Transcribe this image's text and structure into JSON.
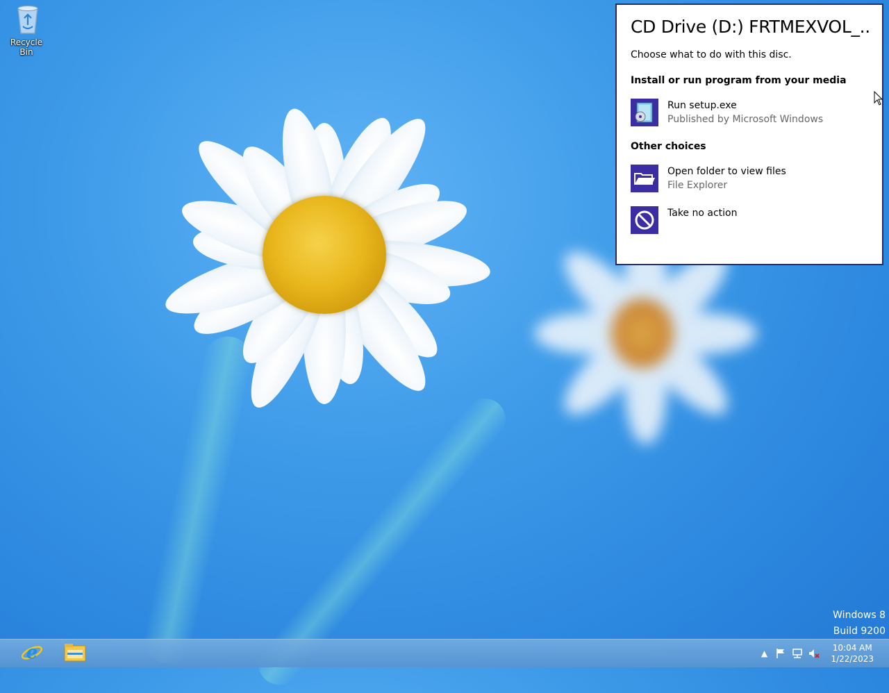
{
  "desktop": {
    "recycle_bin_label": "Recycle Bin",
    "watermark": {
      "line1": "Windows 8",
      "line2": "Build 9200"
    }
  },
  "autoplay": {
    "title": "CD Drive (D:) FRTMEXVOL_...",
    "subtitle": "Choose what to do with this disc.",
    "section_install": "Install or run program from your media",
    "section_other": "Other choices",
    "options": [
      {
        "label": "Run setup.exe",
        "sub": "Published by Microsoft Windows",
        "icon": "setup-disc-icon"
      },
      {
        "label": "Open folder to view files",
        "sub": "File Explorer",
        "icon": "folder-icon"
      },
      {
        "label": "Take no action",
        "sub": "",
        "icon": "no-action-icon"
      }
    ],
    "accent": "#3b2ea3"
  },
  "taskbar": {
    "pinned": [
      "internet-explorer-icon",
      "file-explorer-icon"
    ],
    "tray": [
      "show-hidden-icons",
      "action-center-flag-icon",
      "network-icon",
      "volume-muted-icon"
    ],
    "clock": {
      "time": "10:04 AM",
      "date": "1/22/2023"
    }
  }
}
